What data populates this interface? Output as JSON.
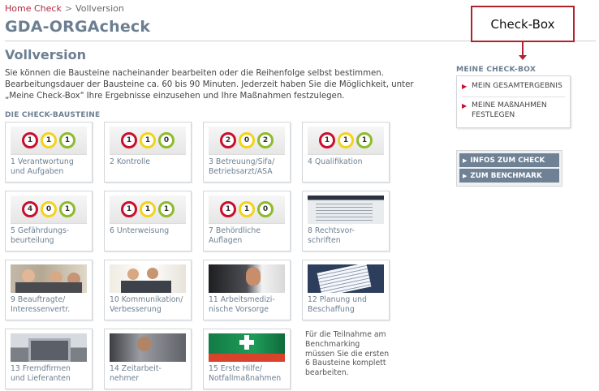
{
  "breadcrumb": {
    "home": "Home Check",
    "separator": ">",
    "current": "Vollversion"
  },
  "app_title": "GDA-ORGAcheck",
  "section_title": "Vollversion",
  "intro": "Sie können die Bausteine nacheinander bearbeiten oder die Reihenfolge selbst bestimmen. Bearbeitungsdauer der Bausteine ca. 60 bis 90 Minuten. Jederzeit haben Sie die Möglichkeit, unter „Meine Check-Box\" Ihre Ergebnisse einzusehen und Ihre Maßnahmen festzulegen.",
  "modules_heading": "DIE CHECK-BAUSTEINE",
  "modules": [
    {
      "label": "1 Verantwortung und Aufgaben",
      "scores": [
        "1",
        "1",
        "1"
      ]
    },
    {
      "label": "2 Kontrolle",
      "scores": [
        "1",
        "1",
        "0"
      ]
    },
    {
      "label": "3 Betreuung/Sifa/ Betriebsarzt/ASA",
      "scores": [
        "2",
        "0",
        "2"
      ]
    },
    {
      "label": "4 Qualifikation",
      "scores": [
        "1",
        "1",
        "1"
      ]
    },
    {
      "label": "5 Gefährdungs-beurteilung",
      "scores": [
        "4",
        "0",
        "1"
      ]
    },
    {
      "label": "6 Unterweisung",
      "scores": [
        "1",
        "1",
        "1"
      ]
    },
    {
      "label": "7 Behördliche Auflagen",
      "scores": [
        "1",
        "1",
        "0"
      ]
    },
    {
      "label": "8 Rechtsvor-schriften",
      "image": "document-photo"
    },
    {
      "label": "9 Beauftragte/ Interessenvertr.",
      "image": "meeting-photo"
    },
    {
      "label": "10 Kommunikation/ Verbesserung",
      "image": "group-photo"
    },
    {
      "label": "11 Arbeitsmedizi-nische Vorsorge",
      "image": "medical-photo"
    },
    {
      "label": "12 Planung und Beschaffung",
      "image": "paper-photo"
    },
    {
      "label": "13 Fremdfirmen und Lieferanten",
      "image": "truck-photo"
    },
    {
      "label": "14 Zeitarbeit-nehmer",
      "image": "worker-photo"
    },
    {
      "label": "15 Erste Hilfe/ Notfallmaßnahmen",
      "image": "first-aid-photo"
    }
  ],
  "benchmark_note": "Für die Teilnahme am Benchmarking müssen Sie die ersten 6 Bausteine komplett bearbeiten.",
  "callout": "Check-Box",
  "checkbox": {
    "heading": "MEINE CHECK-BOX",
    "items": [
      "MEIN GESAMTERGEBNIS",
      "MEINE MAßNAHMEN FESTLEGEN"
    ]
  },
  "buttons": [
    "INFOS ZUM CHECK",
    "ZUM BENCHMARK"
  ],
  "colors": {
    "accent_red": "#c8102e",
    "title_blue_gray": "#6c7f91",
    "score_yellow": "#f3d31a",
    "score_green": "#8dbb2b",
    "button_bg": "#6f8194"
  },
  "icons": {
    "bullet": "triangle-right-icon",
    "callout_arrow": "arrow-down-icon"
  }
}
